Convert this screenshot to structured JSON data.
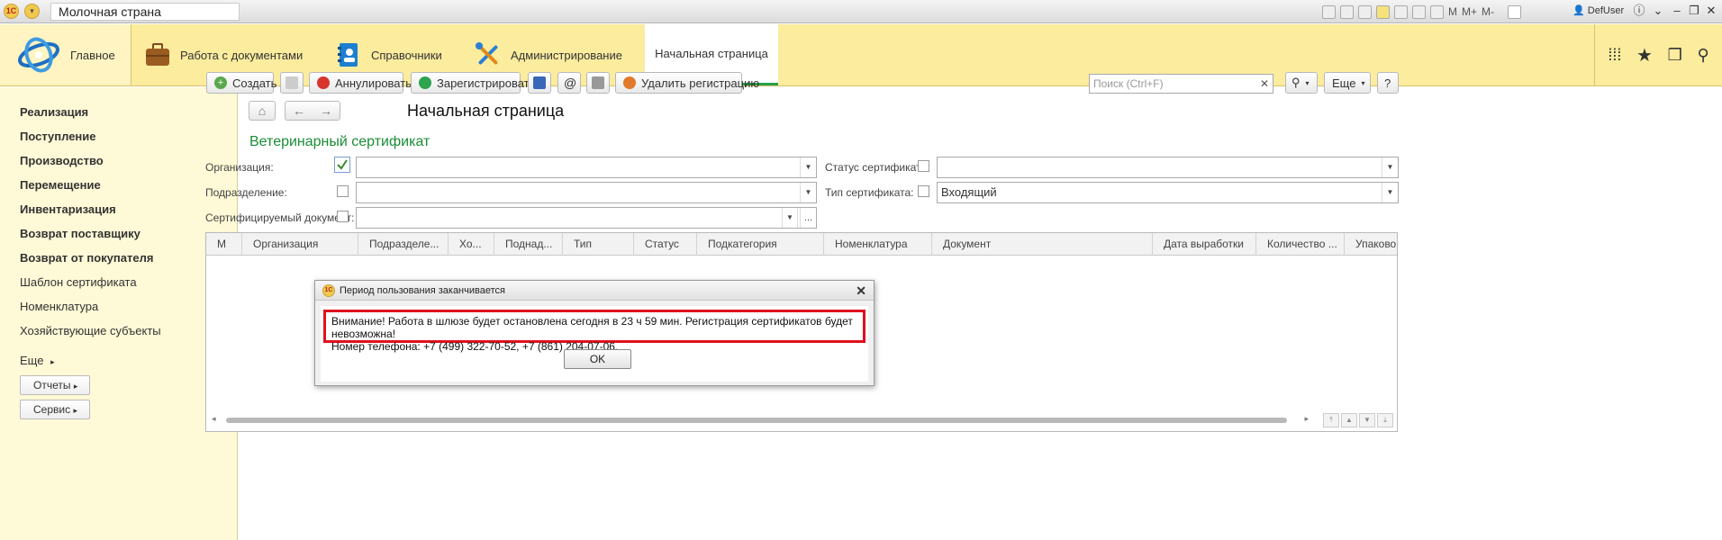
{
  "window": {
    "title": "Молочная страна",
    "toolbar_labels": [
      "M",
      "M+",
      "M-"
    ],
    "user": "DefUser"
  },
  "sections": {
    "home": "Главное",
    "items": [
      "Работа с документами",
      "Справочники",
      "Администрирование"
    ],
    "active_tab": "Начальная страница"
  },
  "leftnav": {
    "bold_items": [
      "Реализация",
      "Поступление",
      "Производство",
      "Перемещение",
      "Инвентаризация",
      "Возврат поставщику",
      "Возврат от покупателя"
    ],
    "items": [
      "Шаблон сертификата",
      "Номенклатура",
      "Хозяйствующие субъекты"
    ],
    "more": "Еще",
    "reports": "Отчеты",
    "service": "Сервис"
  },
  "page": {
    "title": "Начальная страница",
    "form_title": "Ветеринарный сертификат"
  },
  "toolbar": {
    "create": "Создать",
    "cancel_cert": "Аннулировать",
    "register": "Зарегистрировать",
    "email_icon_label": "@",
    "delete_reg": "Удалить регистрацию",
    "search_placeholder": "Поиск (Ctrl+F)",
    "more": "Еще",
    "help": "?"
  },
  "filters": {
    "org_label": "Организация:",
    "dept_label": "Подразделение:",
    "doc_label": "Сертифицируемый документ:",
    "status_label": "Статус сертификата:",
    "type_label": "Тип сертификата:",
    "type_value": "Входящий",
    "org_checked": true
  },
  "table": {
    "columns": [
      "М",
      "Организация",
      "Подразделе...",
      "Хо...",
      "Поднад...",
      "Тип",
      "Статус",
      "Подкатегория",
      "Номенклатура",
      "Документ",
      "Дата выработки",
      "Количество ...",
      "Упаковок"
    ]
  },
  "dialog": {
    "title": "Период пользования заканчивается",
    "message_line1": "Внимание! Работа в шлюзе будет остановлена сегодня в 23 ч 59 мин. Регистрация сертификатов будет невозможна!",
    "message_line2": "Номер телефона: +7 (499) 322-70-52, +7 (861) 204-07-06.",
    "ok": "OK"
  },
  "colors": {
    "section_bg": "#fbec9e",
    "nav_bg": "#fef9d6",
    "accent_green": "#1a8d36",
    "alert_red": "#e0101e"
  }
}
